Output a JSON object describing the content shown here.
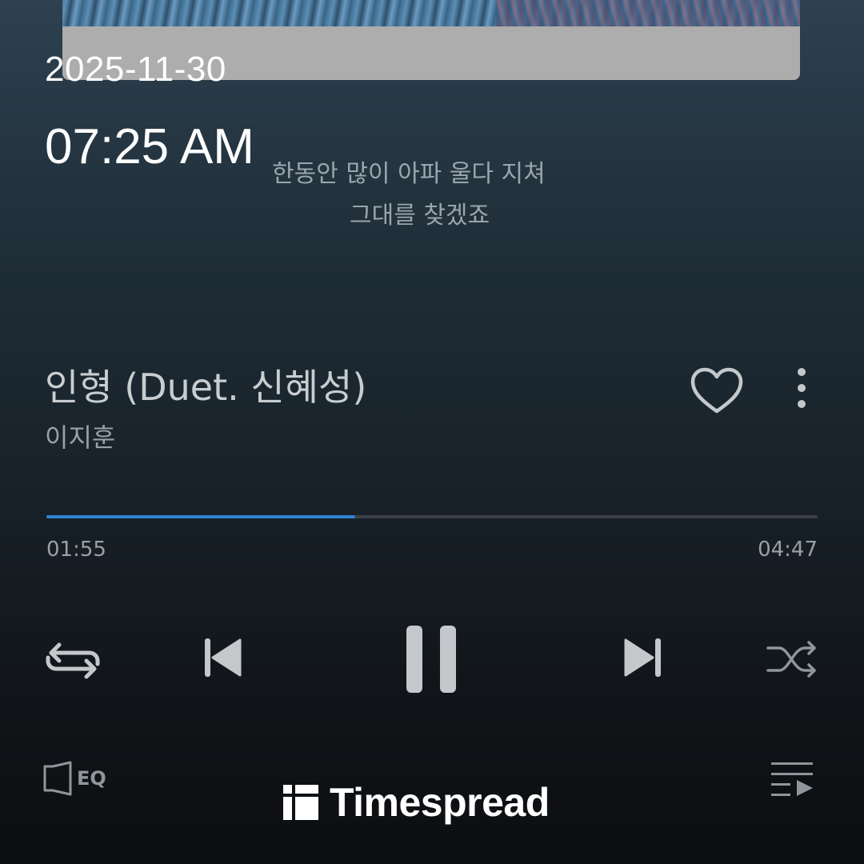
{
  "overlay": {
    "date": "2025-11-30",
    "time": "07:25 AM"
  },
  "lyrics": [
    "한동안 많이 아파 울다 지쳐",
    "그대를 찾겠죠"
  ],
  "song": {
    "title": "인형 (Duet. 신혜성)",
    "artist": "이지훈"
  },
  "progress": {
    "elapsed": "01:55",
    "total": "04:47",
    "fraction": 0.4007
  },
  "controls": {
    "repeat_icon": "repeat-icon",
    "previous_icon": "skip-previous-icon",
    "pause_icon": "pause-icon",
    "next_icon": "skip-next-icon",
    "shuffle_icon": "shuffle-icon"
  },
  "bottom_bar": {
    "eq_label": "EQ",
    "queue_icon": "queue-icon"
  },
  "watermark": {
    "brand": "Timespread"
  },
  "colors": {
    "accent": "#2f84cf",
    "track": "#3b4146",
    "icon": "#c4c8cb"
  }
}
